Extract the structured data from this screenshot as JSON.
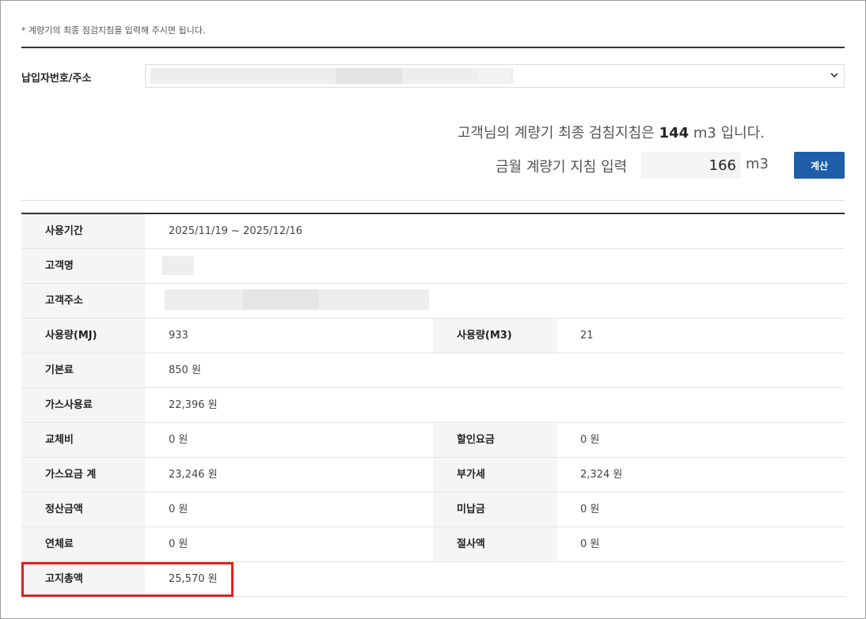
{
  "notice": "* 계량기의 최종 점검지침을 입력해 주시면 됩니다.",
  "address": {
    "label": "납입자번호/주소"
  },
  "summary": {
    "prefix": "고객님의 계량기 최종 검침지침은",
    "last_reading": "144",
    "suffix": "m3 입니다."
  },
  "meter_input": {
    "label": "금월 계량기 지침 입력",
    "value": "166",
    "unit": "m3"
  },
  "calc_button": "계산",
  "rows": [
    {
      "label": "사용기간",
      "value": "2025/11/19 ~ 2025/12/16"
    },
    {
      "label": "고객명",
      "value": ""
    },
    {
      "label": "고객주소",
      "value": ""
    },
    {
      "label": "사용량(MJ)",
      "value": "933",
      "label2": "사용량(M3)",
      "value2": "21"
    },
    {
      "label": "기본료",
      "value": "850 원"
    },
    {
      "label": "가스사용료",
      "value": "22,396 원"
    },
    {
      "label": "교체비",
      "value": "0 원",
      "label2": "할인요금",
      "value2": "0 원"
    },
    {
      "label": "가스요금 계",
      "value": "23,246 원",
      "label2": "부가세",
      "value2": "2,324 원"
    },
    {
      "label": "정산금액",
      "value": "0 원",
      "label2": "미납금",
      "value2": "0 원"
    },
    {
      "label": "연체료",
      "value": "0 원",
      "label2": "절사액",
      "value2": "0 원"
    },
    {
      "label": "고지총액",
      "value": "25,570 원"
    }
  ],
  "colors": {
    "accent": "#1e5ea8",
    "highlight": "#e02020",
    "header_bg": "#f5f5f5"
  }
}
